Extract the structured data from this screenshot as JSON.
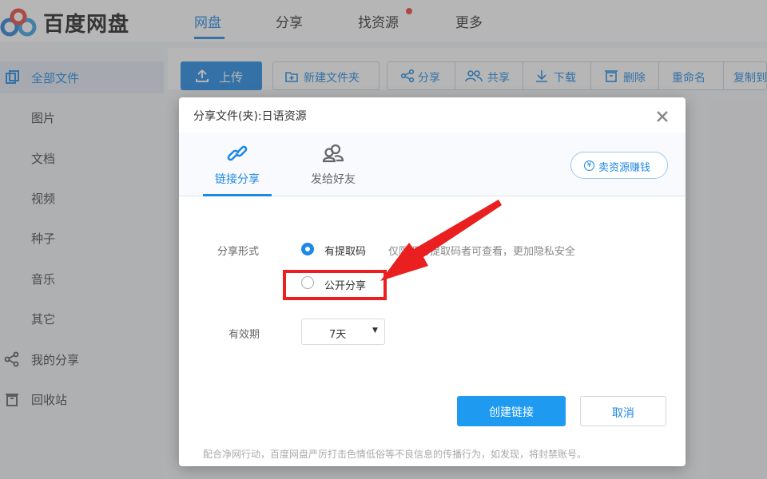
{
  "app": {
    "name": "百度网盘"
  },
  "nav": {
    "items": [
      "网盘",
      "分享",
      "找资源",
      "更多"
    ]
  },
  "sidebar": {
    "items": [
      "全部文件",
      "图片",
      "文档",
      "视频",
      "种子",
      "音乐",
      "其它",
      "我的分享",
      "回收站"
    ]
  },
  "toolbar": {
    "upload": "上传",
    "new_folder": "新建文件夹",
    "share": "分享",
    "co_share": "共享",
    "download": "下载",
    "delete": "删除",
    "rename": "重命名",
    "copy_to": "复制到"
  },
  "dialog": {
    "title": "分享文件(夹):日语资源",
    "tabs": [
      "链接分享",
      "发给好友"
    ],
    "sell_button": "卖资源赚钱",
    "share_form_label": "分享形式",
    "option_code": "有提取码",
    "option_code_hint": "仅限拥有提取码者可查看，更加隐私安全",
    "option_public": "公开分享",
    "validity_label": "有效期",
    "validity_value": "7天",
    "create_button": "创建链接",
    "cancel_button": "取消",
    "notice": "配合净网行动，百度网盘严厉打击色情低俗等不良信息的传播行为，如发现，将封禁账号。"
  },
  "colors": {
    "accent": "#1e88e5",
    "annotation": "#ea1f1f"
  }
}
